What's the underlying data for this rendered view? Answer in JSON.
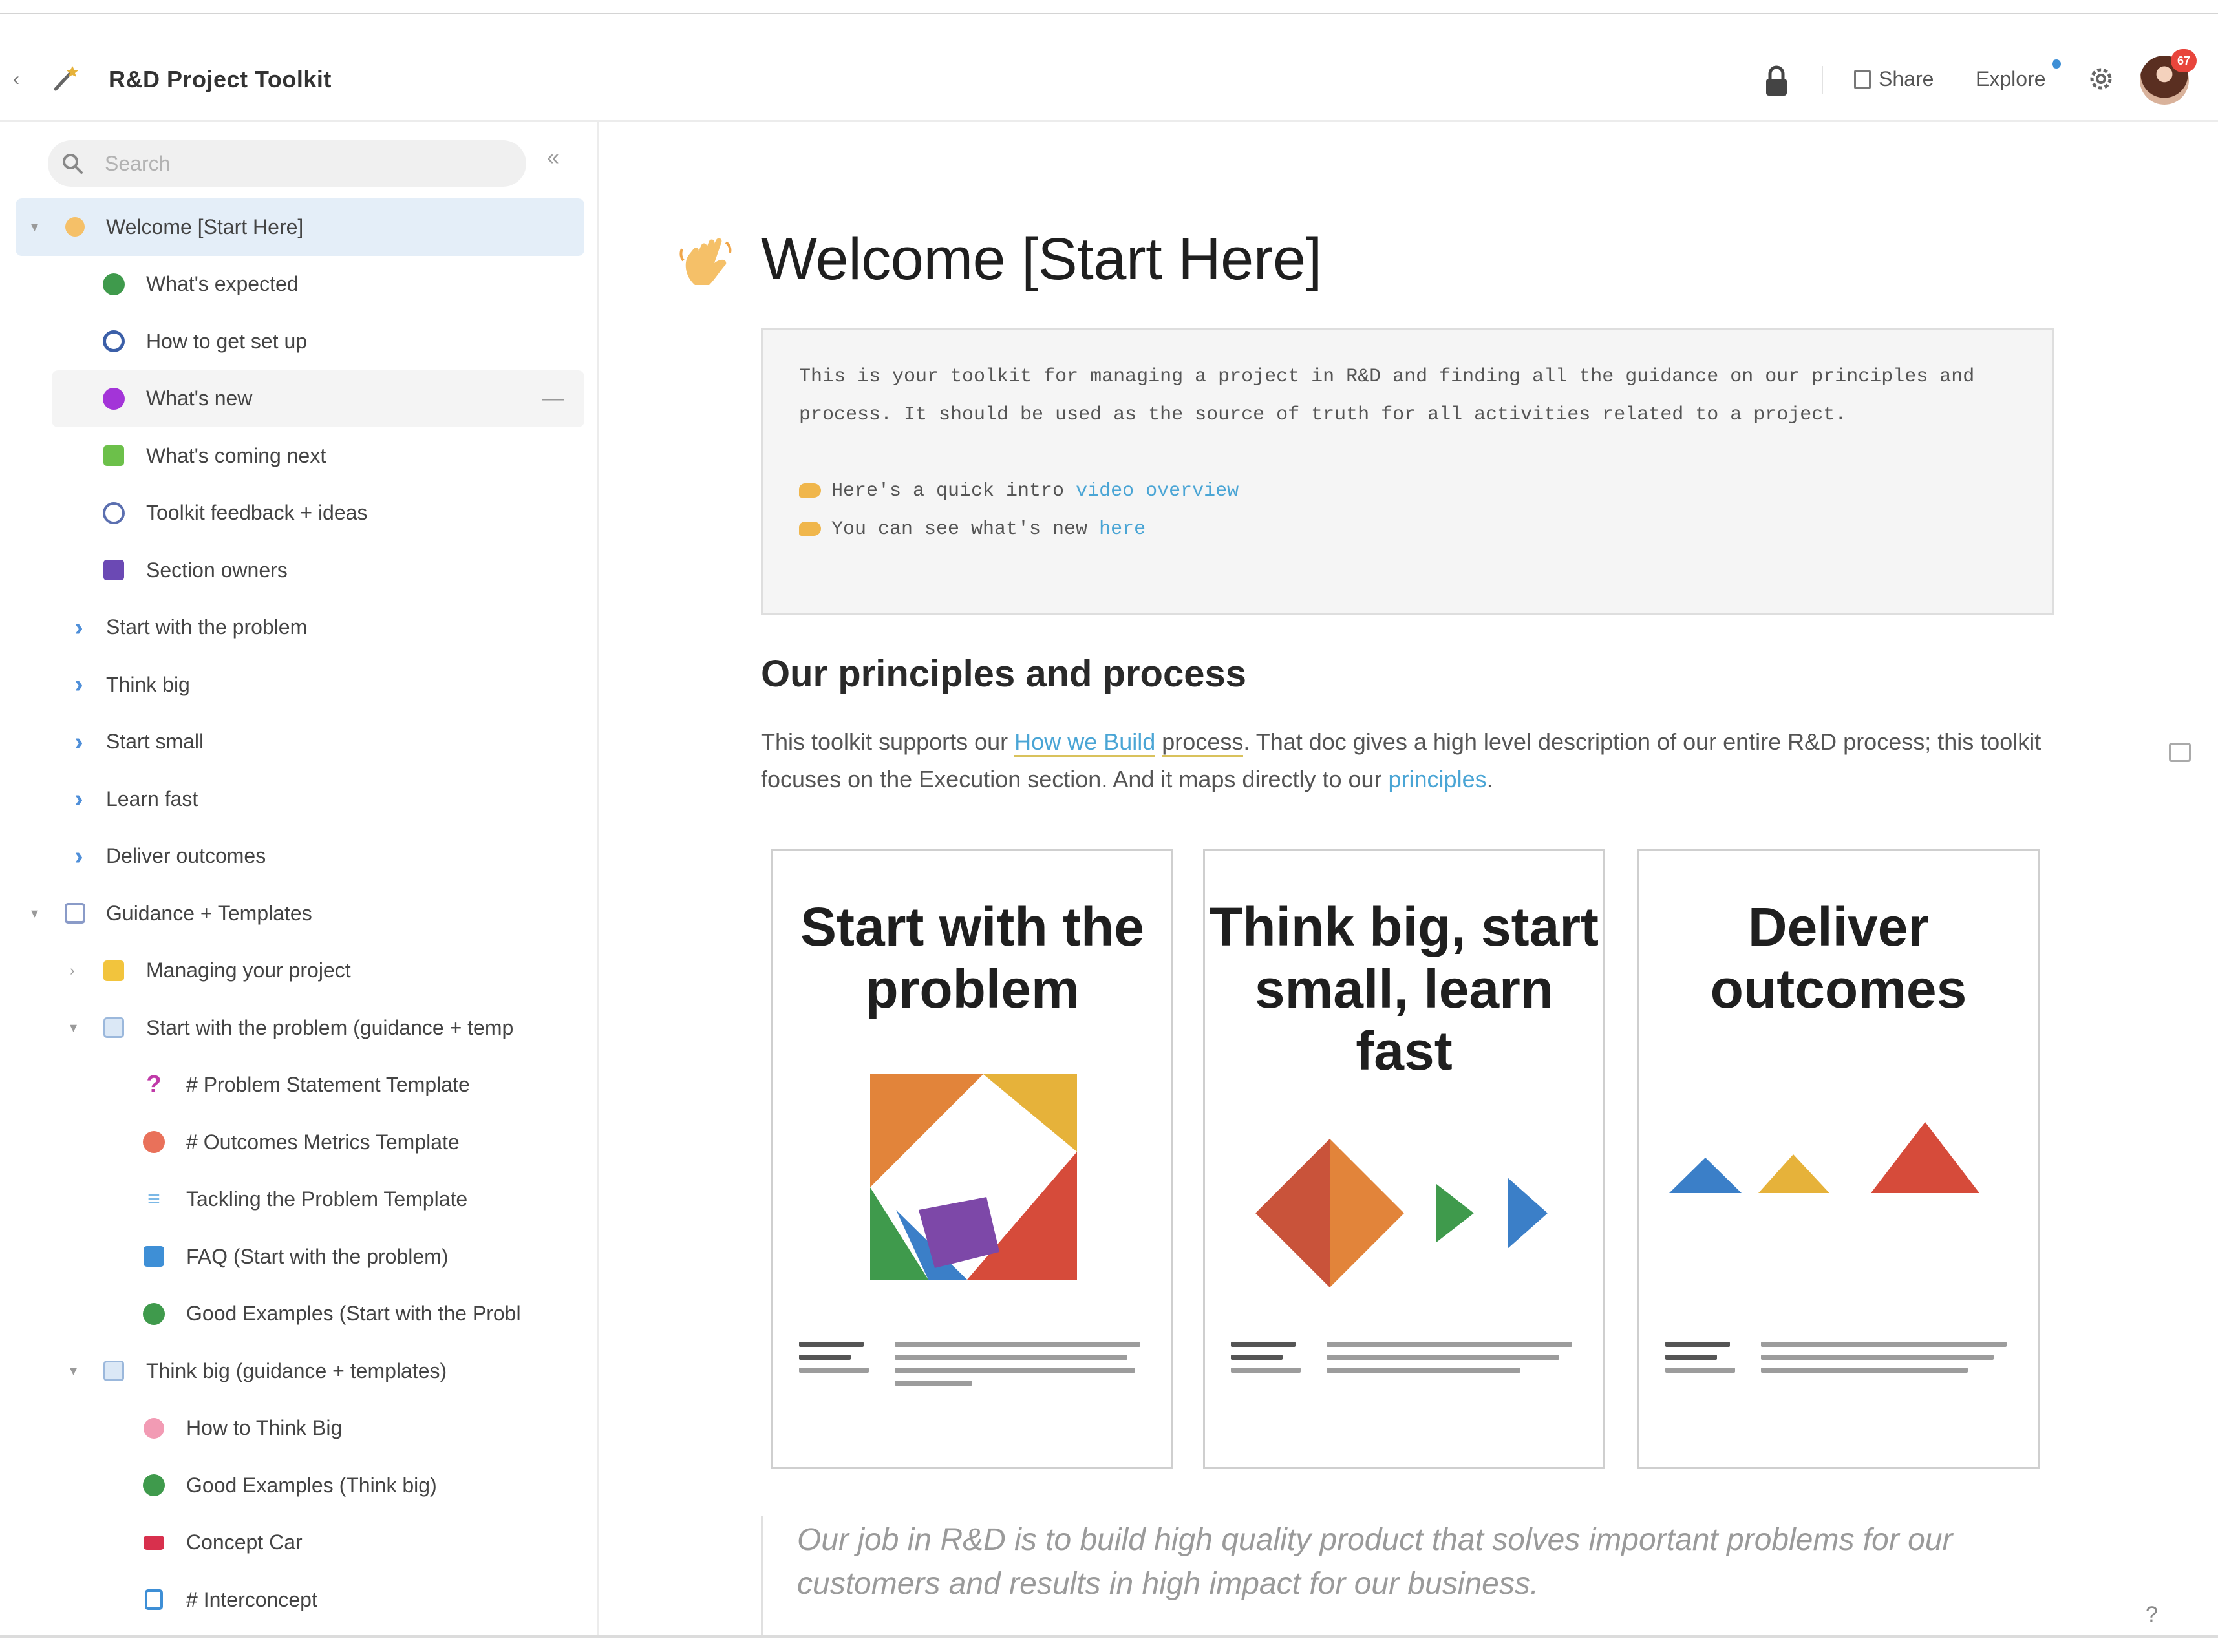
{
  "header": {
    "back_icon": "chevron-left-icon",
    "app_icon": "magic-wand-icon",
    "title": "R&D Project Toolkit",
    "lock_icon": "lock-icon",
    "share_label": "Share",
    "explore_label": "Explore",
    "settings_icon": "gear-icon",
    "avatar_badge": "67"
  },
  "sidebar": {
    "search_placeholder": "Search",
    "collapse_icon": "double-chevron-left-icon",
    "items": [
      {
        "label": "Welcome [Start Here]",
        "icon": "wave-hand-icon",
        "level": 0,
        "caret": "▾",
        "active": true
      },
      {
        "label": "What's expected",
        "icon": "check-circle-icon",
        "level": 1
      },
      {
        "label": "How to get set up",
        "icon": "key-icon",
        "level": 1
      },
      {
        "label": "What's new",
        "icon": "sparkle-icon",
        "level": 1,
        "hover": true
      },
      {
        "label": "What's coming next",
        "icon": "calendar-icon",
        "level": 1
      },
      {
        "label": "Toolkit feedback + ideas",
        "icon": "clock-icon",
        "level": 1
      },
      {
        "label": "Section owners",
        "icon": "people-icon",
        "level": 1
      },
      {
        "label": "Start with the problem",
        "icon": "double-chevron-right-icon",
        "level": 0
      },
      {
        "label": "Think big",
        "icon": "double-chevron-right-icon",
        "level": 0
      },
      {
        "label": "Start small",
        "icon": "double-chevron-right-icon",
        "level": 0
      },
      {
        "label": "Learn fast",
        "icon": "double-chevron-right-icon",
        "level": 0
      },
      {
        "label": "Deliver outcomes",
        "icon": "double-chevron-right-icon",
        "level": 0
      },
      {
        "label": "Guidance + Templates",
        "icon": "document-icon",
        "level": 0,
        "caret": "▾"
      },
      {
        "label": "Managing your project",
        "icon": "folder-icon",
        "level": 1,
        "caret": "›"
      },
      {
        "label": "Start with the problem (guidance + temp",
        "icon": "grid-icon",
        "level": 1,
        "caret": "▾"
      },
      {
        "label": "# Problem Statement Template",
        "icon": "question-mark-icon",
        "level": 2
      },
      {
        "label": "# Outcomes Metrics Template",
        "icon": "target-icon",
        "level": 2
      },
      {
        "label": "Tackling the Problem Template",
        "icon": "steps-icon",
        "level": 2
      },
      {
        "label": "FAQ (Start with the problem)",
        "icon": "chat-icon",
        "level": 2
      },
      {
        "label": "Good Examples (Start with the Probl",
        "icon": "check-circle-icon",
        "level": 2
      },
      {
        "label": "Think big (guidance + templates)",
        "icon": "grid-icon",
        "level": 1,
        "caret": "▾"
      },
      {
        "label": "How to Think Big",
        "icon": "bubble-icon",
        "level": 2
      },
      {
        "label": "Good Examples (Think big)",
        "icon": "check-circle-icon",
        "level": 2
      },
      {
        "label": "Concept Car",
        "icon": "car-icon",
        "level": 2
      },
      {
        "label": "# Interconcept",
        "icon": "file-icon",
        "level": 2
      }
    ]
  },
  "main": {
    "title_icon": "wave-hand-icon",
    "title": "Welcome [Start Here]",
    "callout": {
      "intro": "This is your toolkit for managing a project in R&D and finding all the guidance on our principles and process. It should be used as the source of truth for all activities related to a project.",
      "bullet1_text": "Here's a quick intro ",
      "bullet1_link": "video overview",
      "bullet2_text": "You can see what's new ",
      "bullet2_link": "here"
    },
    "section_heading": "Our principles and process",
    "para": {
      "t1": "This toolkit supports our ",
      "link1": "How we Build",
      "link1b": "process",
      "t2": ". That doc gives a high level description of our entire R&D process; this toolkit focuses on the Execution section. And it maps directly to our ",
      "link2": "principles",
      "t3": "."
    },
    "cards": [
      {
        "title": "Start with the problem"
      },
      {
        "title": "Think big, start small, learn fast"
      },
      {
        "title": "Deliver outcomes"
      }
    ],
    "quote": "Our job in R&D is to build high quality product that solves important problems for our customers and results in high impact for our business.",
    "help_label": "?"
  },
  "colors": {
    "accent_blue": "#4f8fd9",
    "link": "#4aa5d5",
    "active_bg": "#e4eef8",
    "orange": "#e2843a",
    "yellow": "#e6b23a",
    "red": "#d64b3a",
    "green": "#3f9a4c",
    "purple": "#7d48a8"
  }
}
